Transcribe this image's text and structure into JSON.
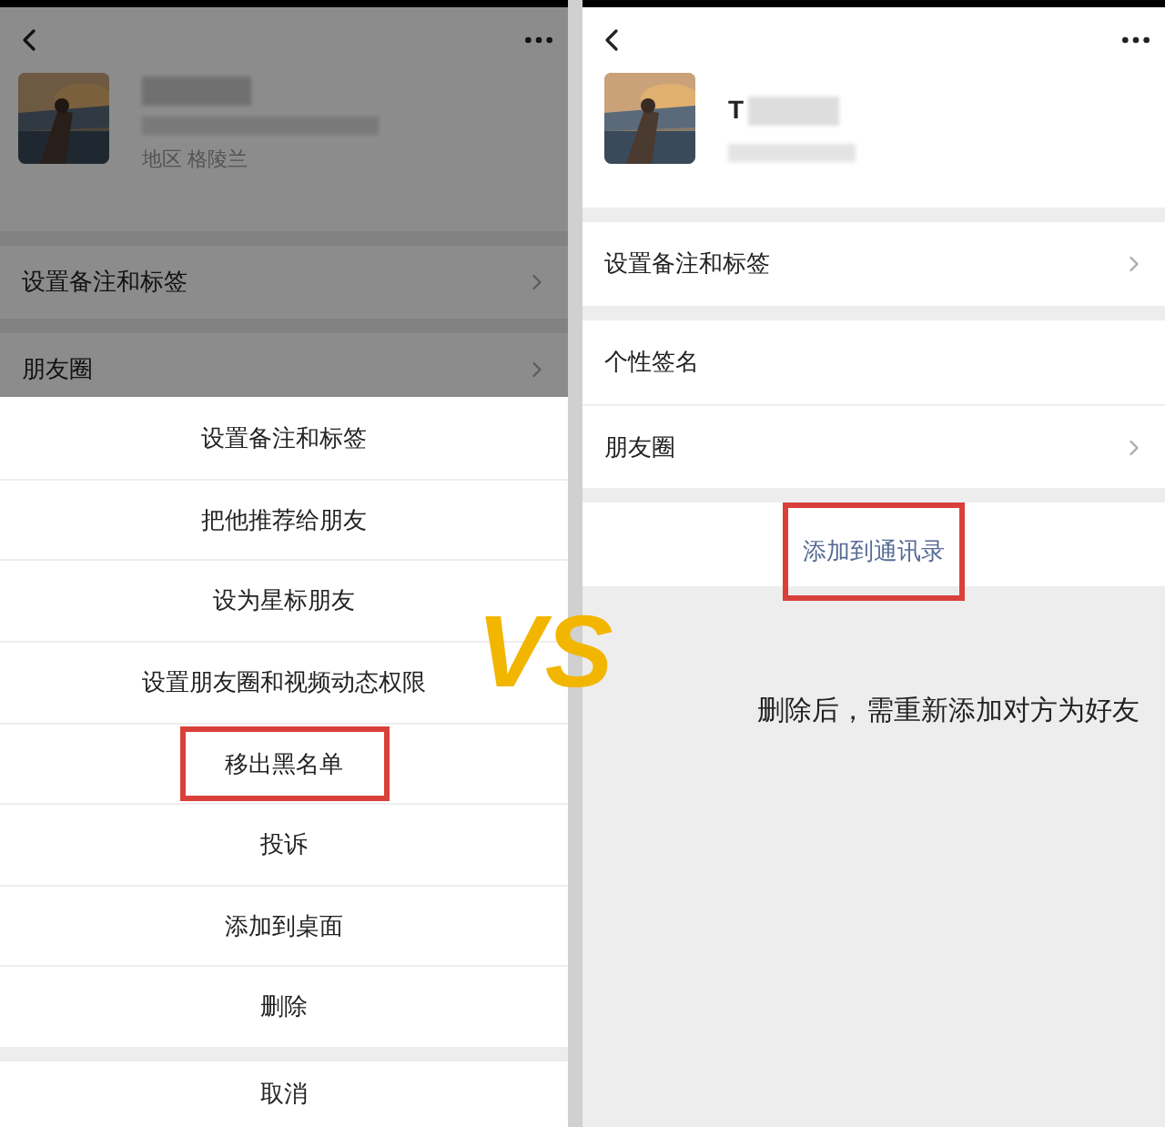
{
  "left_screen": {
    "profile": {
      "region": "地区  格陵兰"
    },
    "row_groups": [
      [
        {
          "label": "设置备注和标签",
          "kind": "link"
        }
      ],
      [
        {
          "label": "朋友圈",
          "kind": "link"
        }
      ]
    ],
    "action_sheet": {
      "items": [
        {
          "label": "设置备注和标签",
          "highlighted": false
        },
        {
          "label": "把他推荐给朋友",
          "highlighted": false
        },
        {
          "label": "设为星标朋友",
          "highlighted": false
        },
        {
          "label": "设置朋友圈和视频动态权限",
          "highlighted": false
        },
        {
          "label": "移出黑名单",
          "highlighted": true
        },
        {
          "label": "投诉",
          "highlighted": false
        },
        {
          "label": "添加到桌面",
          "highlighted": false
        },
        {
          "label": "删除",
          "highlighted": false
        }
      ],
      "cancel": "取消"
    }
  },
  "comparison_mark": "VS",
  "right_screen": {
    "profile": {
      "name": "T"
    },
    "row_groups": [
      [
        {
          "label": "设置备注和标签",
          "kind": "link"
        }
      ],
      [
        {
          "label": "个性签名",
          "kind": "plain"
        },
        {
          "label": "朋友圈",
          "kind": "link"
        }
      ]
    ],
    "add_button": {
      "label": "添加到通讯录",
      "highlighted": true
    },
    "note": "删除后，需重新添加对方为好友"
  }
}
